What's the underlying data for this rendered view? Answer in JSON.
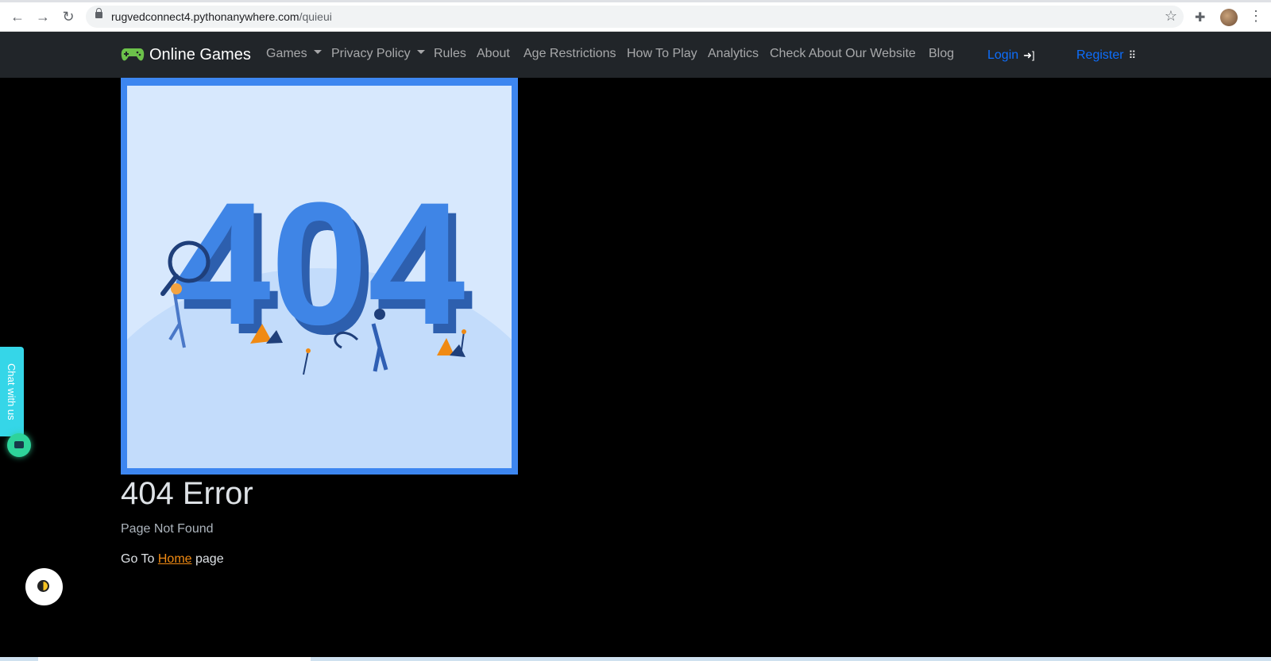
{
  "browser": {
    "url_host": "rugvedconnect4.pythonanywhere.com",
    "url_path": "/quieui",
    "back_icon": "arrow-left-icon",
    "forward_icon": "arrow-right-icon",
    "reload_icon": "reload-icon",
    "bookmark_icon": "star-icon",
    "extensions_icon": "puzzle-icon",
    "menu_icon": "kebab-menu-icon"
  },
  "navbar": {
    "brand": "Online Games",
    "brand_icon": "gamepad-icon",
    "links": [
      {
        "label": "Games",
        "dropdown": true
      },
      {
        "label": "Privacy Policy",
        "dropdown": true
      },
      {
        "label": "Rules"
      },
      {
        "label": "About"
      },
      {
        "label": "Age Restrictions"
      },
      {
        "label": "How To Play"
      },
      {
        "label": "Analytics"
      },
      {
        "label": "Check About Our Website"
      },
      {
        "label": "Blog"
      }
    ],
    "login": "Login",
    "register": "Register",
    "accent_color": "#0d6efd"
  },
  "illustration": {
    "text": "404",
    "frame_color": "#3d86f0",
    "number_color": "#3f85e6"
  },
  "error": {
    "title": "404 Error",
    "subtitle": "Page Not Found",
    "goto_prefix": "Go To",
    "home_link": "Home",
    "goto_suffix": "page",
    "link_color": "#f08a13"
  },
  "chat": {
    "label": "Chat with us",
    "color": "#35d6e8"
  }
}
